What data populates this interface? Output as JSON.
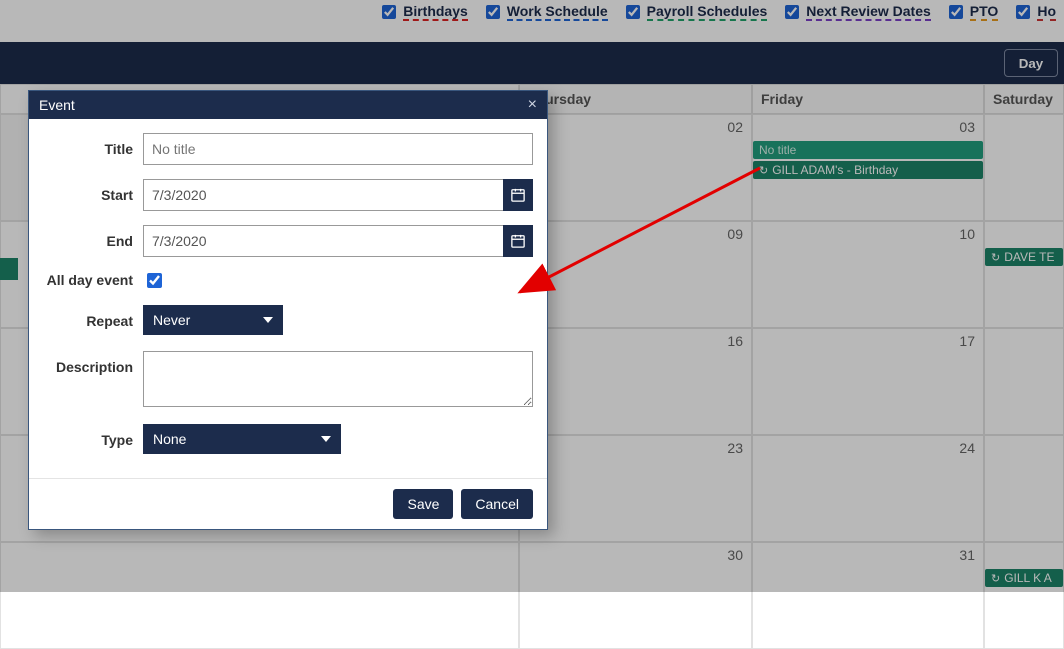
{
  "filters": {
    "birthdays": {
      "label": "Birthdays",
      "checked": true
    },
    "work": {
      "label": "Work Schedule",
      "checked": true
    },
    "payroll": {
      "label": "Payroll Schedules",
      "checked": true
    },
    "review": {
      "label": "Next Review Dates",
      "checked": true
    },
    "pto": {
      "label": "PTO",
      "checked": true
    },
    "ho": {
      "label": "Ho",
      "checked": true
    }
  },
  "toolbar": {
    "day_btn": "Day"
  },
  "calendar": {
    "headers": {
      "thursday": "Thursday",
      "friday": "Friday",
      "saturday": "Saturday"
    },
    "days": {
      "r1thu": "02",
      "r1fri": "03",
      "r1sat": "",
      "r2thu": "09",
      "r2fri": "10",
      "r2sat": "",
      "r3thu": "16",
      "r3fri": "17",
      "r3sat": "",
      "r4thu": "23",
      "r4fri": "24",
      "r4sat": "",
      "r5thu": "30",
      "r5fri": "31",
      "r5sat": ""
    },
    "events": {
      "fri03a": "No title",
      "fri03b": "GILL ADAM's - Birthday",
      "sat1": "DAVE TE",
      "sat4": "GILL K A"
    }
  },
  "modal": {
    "title": "Event",
    "labels": {
      "title": "Title",
      "start": "Start",
      "end": "End",
      "allday": "All day event",
      "repeat": "Repeat",
      "description": "Description",
      "type": "Type"
    },
    "fields": {
      "title_placeholder": "No title",
      "start": "7/3/2020",
      "end": "7/3/2020",
      "allday_checked": true,
      "repeat_value": "Never",
      "description": "",
      "type_value": "None"
    },
    "buttons": {
      "save": "Save",
      "cancel": "Cancel"
    }
  }
}
